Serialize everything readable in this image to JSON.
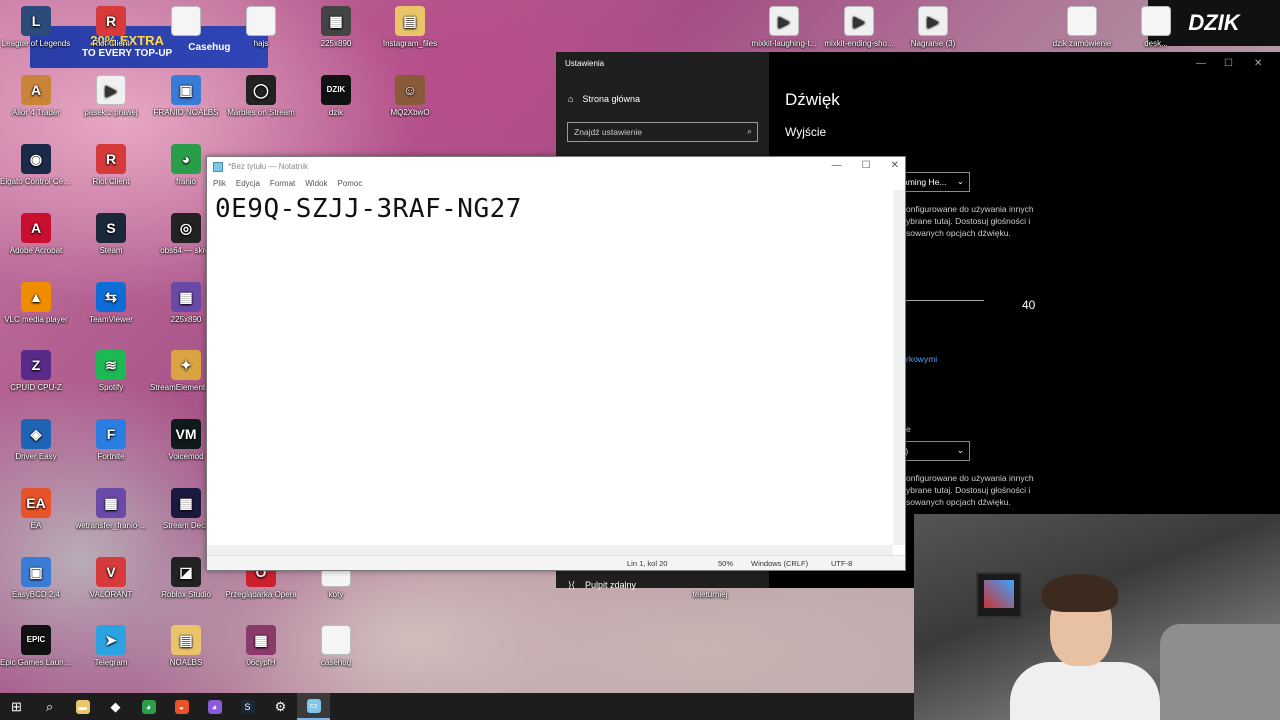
{
  "banner": {
    "line1": "20% EXTRA",
    "line2": "TO EVERY TOP-UP",
    "brand": "Casehug"
  },
  "brand_logo": "DZIK",
  "desktop_icons": [
    {
      "label": "League of Legends",
      "color": "#2c4a7a",
      "glyph": "L"
    },
    {
      "label": "Riot Client",
      "color": "#d63a3a",
      "glyph": "R"
    },
    {
      "label": "",
      "color": "#f5f5f5",
      "glyph": ""
    },
    {
      "label": "hajs",
      "color": "#f5f5f5",
      "glyph": ""
    },
    {
      "label": "225x890",
      "color": "#444",
      "glyph": "▦"
    },
    {
      "label": "Instagram_files",
      "color": "#e9c46a",
      "glyph": "▤"
    },
    {
      "label": "mixkit-laughing-t...",
      "color": "#f0f0f0",
      "glyph": "▶"
    },
    {
      "label": "mixkit-ending-sho...",
      "color": "#f0f0f0",
      "glyph": "▶"
    },
    {
      "label": "Nagranie (3)",
      "color": "#f0f0f0",
      "glyph": "▶"
    },
    {
      "label": "dzik zamówienie",
      "color": "#f5f5f5",
      "glyph": ""
    },
    {
      "label": "desk...",
      "color": "#f5f5f5",
      "glyph": ""
    },
    {
      "label": "Alior 4 Trader",
      "color": "#c9843a",
      "glyph": "A"
    },
    {
      "label": "pasek z prawej",
      "color": "#f0f0f0",
      "glyph": "▶"
    },
    {
      "label": "FRANIO NOALBS",
      "color": "#3a7bd5",
      "glyph": "▣"
    },
    {
      "label": "Marbles on Stream",
      "color": "#222",
      "glyph": "◯"
    },
    {
      "label": "dzik",
      "color": "#111",
      "glyph": "DZIK"
    },
    {
      "label": "MQ2XbwO",
      "color": "#8a5a3a",
      "glyph": "☺"
    },
    {
      "label": "Elgato Control Center",
      "color": "#1a2a48",
      "glyph": "◉"
    },
    {
      "label": "Riot Client",
      "color": "#d63a3a",
      "glyph": "R"
    },
    {
      "label": "franio",
      "color": "#2a9d4a",
      "glyph": "◕"
    },
    {
      "label": "Adobe Acrobat",
      "color": "#c8102e",
      "glyph": "A"
    },
    {
      "label": "Steam",
      "color": "#1b2838",
      "glyph": "S"
    },
    {
      "label": "obs64 — skrót",
      "color": "#222",
      "glyph": "◎"
    },
    {
      "label": "VLC media player",
      "color": "#f08c00",
      "glyph": "▲"
    },
    {
      "label": "TeamViewer",
      "color": "#0e6dd9",
      "glyph": "⇆"
    },
    {
      "label": "225x890",
      "color": "#6a4aa8",
      "glyph": "▦"
    },
    {
      "label": "CPUID CPU-Z",
      "color": "#5a2a8a",
      "glyph": "Z"
    },
    {
      "label": "Spotify",
      "color": "#1db954",
      "glyph": "≋"
    },
    {
      "label": "StreamElements SE.Live",
      "color": "#d9a441",
      "glyph": "✦"
    },
    {
      "label": "Driver Easy",
      "color": "#1e64b4",
      "glyph": "◈"
    },
    {
      "label": "Fortnite",
      "color": "#2a7de1",
      "glyph": "F"
    },
    {
      "label": "Voicemod",
      "color": "#0f1a1a",
      "glyph": "VM"
    },
    {
      "label": "EA",
      "color": "#e8542a",
      "glyph": "EA"
    },
    {
      "label": "wetransfer_franio-...",
      "color": "#6a4aa8",
      "glyph": "▦"
    },
    {
      "label": "Stream Deck",
      "color": "#1a1a40",
      "glyph": "▦"
    },
    {
      "label": "EasyBCD 2.4",
      "color": "#3a7bd5",
      "glyph": "▣"
    },
    {
      "label": "VALORANT",
      "color": "#d63a3a",
      "glyph": "V"
    },
    {
      "label": "Roblox Studio",
      "color": "#222",
      "glyph": "◪"
    },
    {
      "label": "Przeglądarka Opera",
      "color": "#cc1f2d",
      "glyph": "O"
    },
    {
      "label": "koty",
      "color": "#f5f5f5",
      "glyph": ""
    },
    {
      "label": "Epic Games Launcher",
      "color": "#111",
      "glyph": "EPIC"
    },
    {
      "label": "Telegram",
      "color": "#2aa3e0",
      "glyph": "➤"
    },
    {
      "label": "NOALBS",
      "color": "#e9c46a",
      "glyph": "▤"
    },
    {
      "label": "06cypfH",
      "color": "#8a3a6a",
      "glyph": "▦"
    },
    {
      "label": "casehug",
      "color": "#f5f5f5",
      "glyph": ""
    },
    {
      "label": "teleturniej",
      "color": "#f5f5f5",
      "glyph": ""
    }
  ],
  "settings": {
    "window_title": "Ustawienia",
    "home": "Strona główna",
    "search_placeholder": "Znajdź ustawienie",
    "heading": "Dźwięk",
    "section": "Wyjście",
    "output_device": "aming He...",
    "desc1": "onfigurowane do używania innych\nybrane tutaj. Dostosuj głośności i\nsowanych opcjach dźwięku.",
    "volume": "40",
    "link": "rkowymi",
    "input_label": "e",
    "input_device": "t)",
    "desc2": "onfigurowane do używania innych\nybrane tutaj. Dostosuj głośności i\nsowanych opcjach dźwięku.",
    "remote": "Pulpit zdalny"
  },
  "notepad": {
    "title": "*Bez tytułu — Notatnik",
    "menu": [
      "Plik",
      "Edycja",
      "Format",
      "Widok",
      "Pomoc"
    ],
    "content": "0E9Q-SZJJ-3RAF-NG27",
    "status": {
      "position": "Lin 1, kol 20",
      "zoom": "50%",
      "line_ending": "Windows (CRLF)",
      "encoding": "UTF-8"
    }
  },
  "taskbar": [
    {
      "name": "start-icon",
      "glyph": "⊞"
    },
    {
      "name": "search-icon",
      "glyph": "⌕"
    },
    {
      "name": "file-explorer-icon",
      "glyph": "▬",
      "color": "#e9c46a"
    },
    {
      "name": "app-icon",
      "glyph": "◆"
    },
    {
      "name": "chrome-icon",
      "glyph": "◕",
      "color": "#2a9d4a"
    },
    {
      "name": "app-icon-2",
      "glyph": "◒",
      "color": "#e8542a"
    },
    {
      "name": "chrome-icon-2",
      "glyph": "◕",
      "color": "#8a5ad8"
    },
    {
      "name": "steam-icon",
      "glyph": "S",
      "color": "#1b2838"
    },
    {
      "name": "settings-icon",
      "glyph": "⚙"
    },
    {
      "name": "notepad-icon",
      "glyph": "▭",
      "color": "#7fc7e8",
      "active": true
    }
  ]
}
